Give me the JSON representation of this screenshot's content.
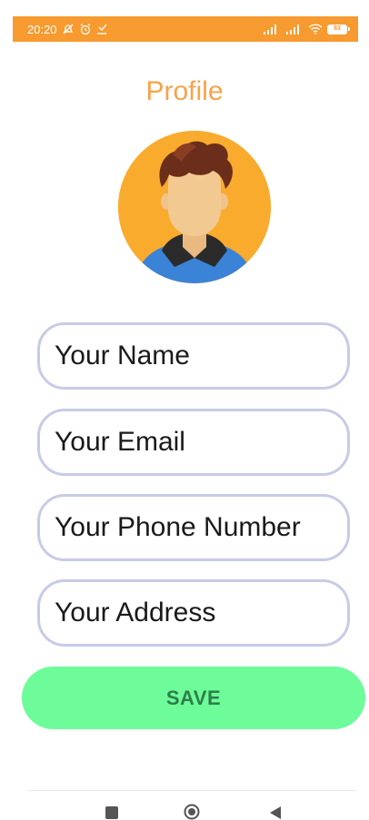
{
  "status_bar": {
    "time": "20:20",
    "battery": "83",
    "icons": [
      "notification-off-icon",
      "alarm-icon",
      "download-icon",
      "signal-icon",
      "signal-icon",
      "wifi-icon",
      "battery-icon"
    ],
    "background_color": "#f79a2f"
  },
  "page": {
    "title": "Profile",
    "title_color": "#f7a24a"
  },
  "avatar": {
    "icon": "user-avatar-icon",
    "background_color": "#f9ab2e"
  },
  "form": {
    "name_placeholder": "Your Name",
    "email_placeholder": "Your Email",
    "phone_placeholder": "Your Phone Number",
    "address_placeholder": "Your Address",
    "border_color": "#c7cbe6"
  },
  "save": {
    "label": "SAVE",
    "background_color": "#6dfc99",
    "text_color": "#2e7d4a"
  },
  "nav": {
    "icons": [
      "recents-icon",
      "home-icon",
      "back-icon"
    ]
  }
}
